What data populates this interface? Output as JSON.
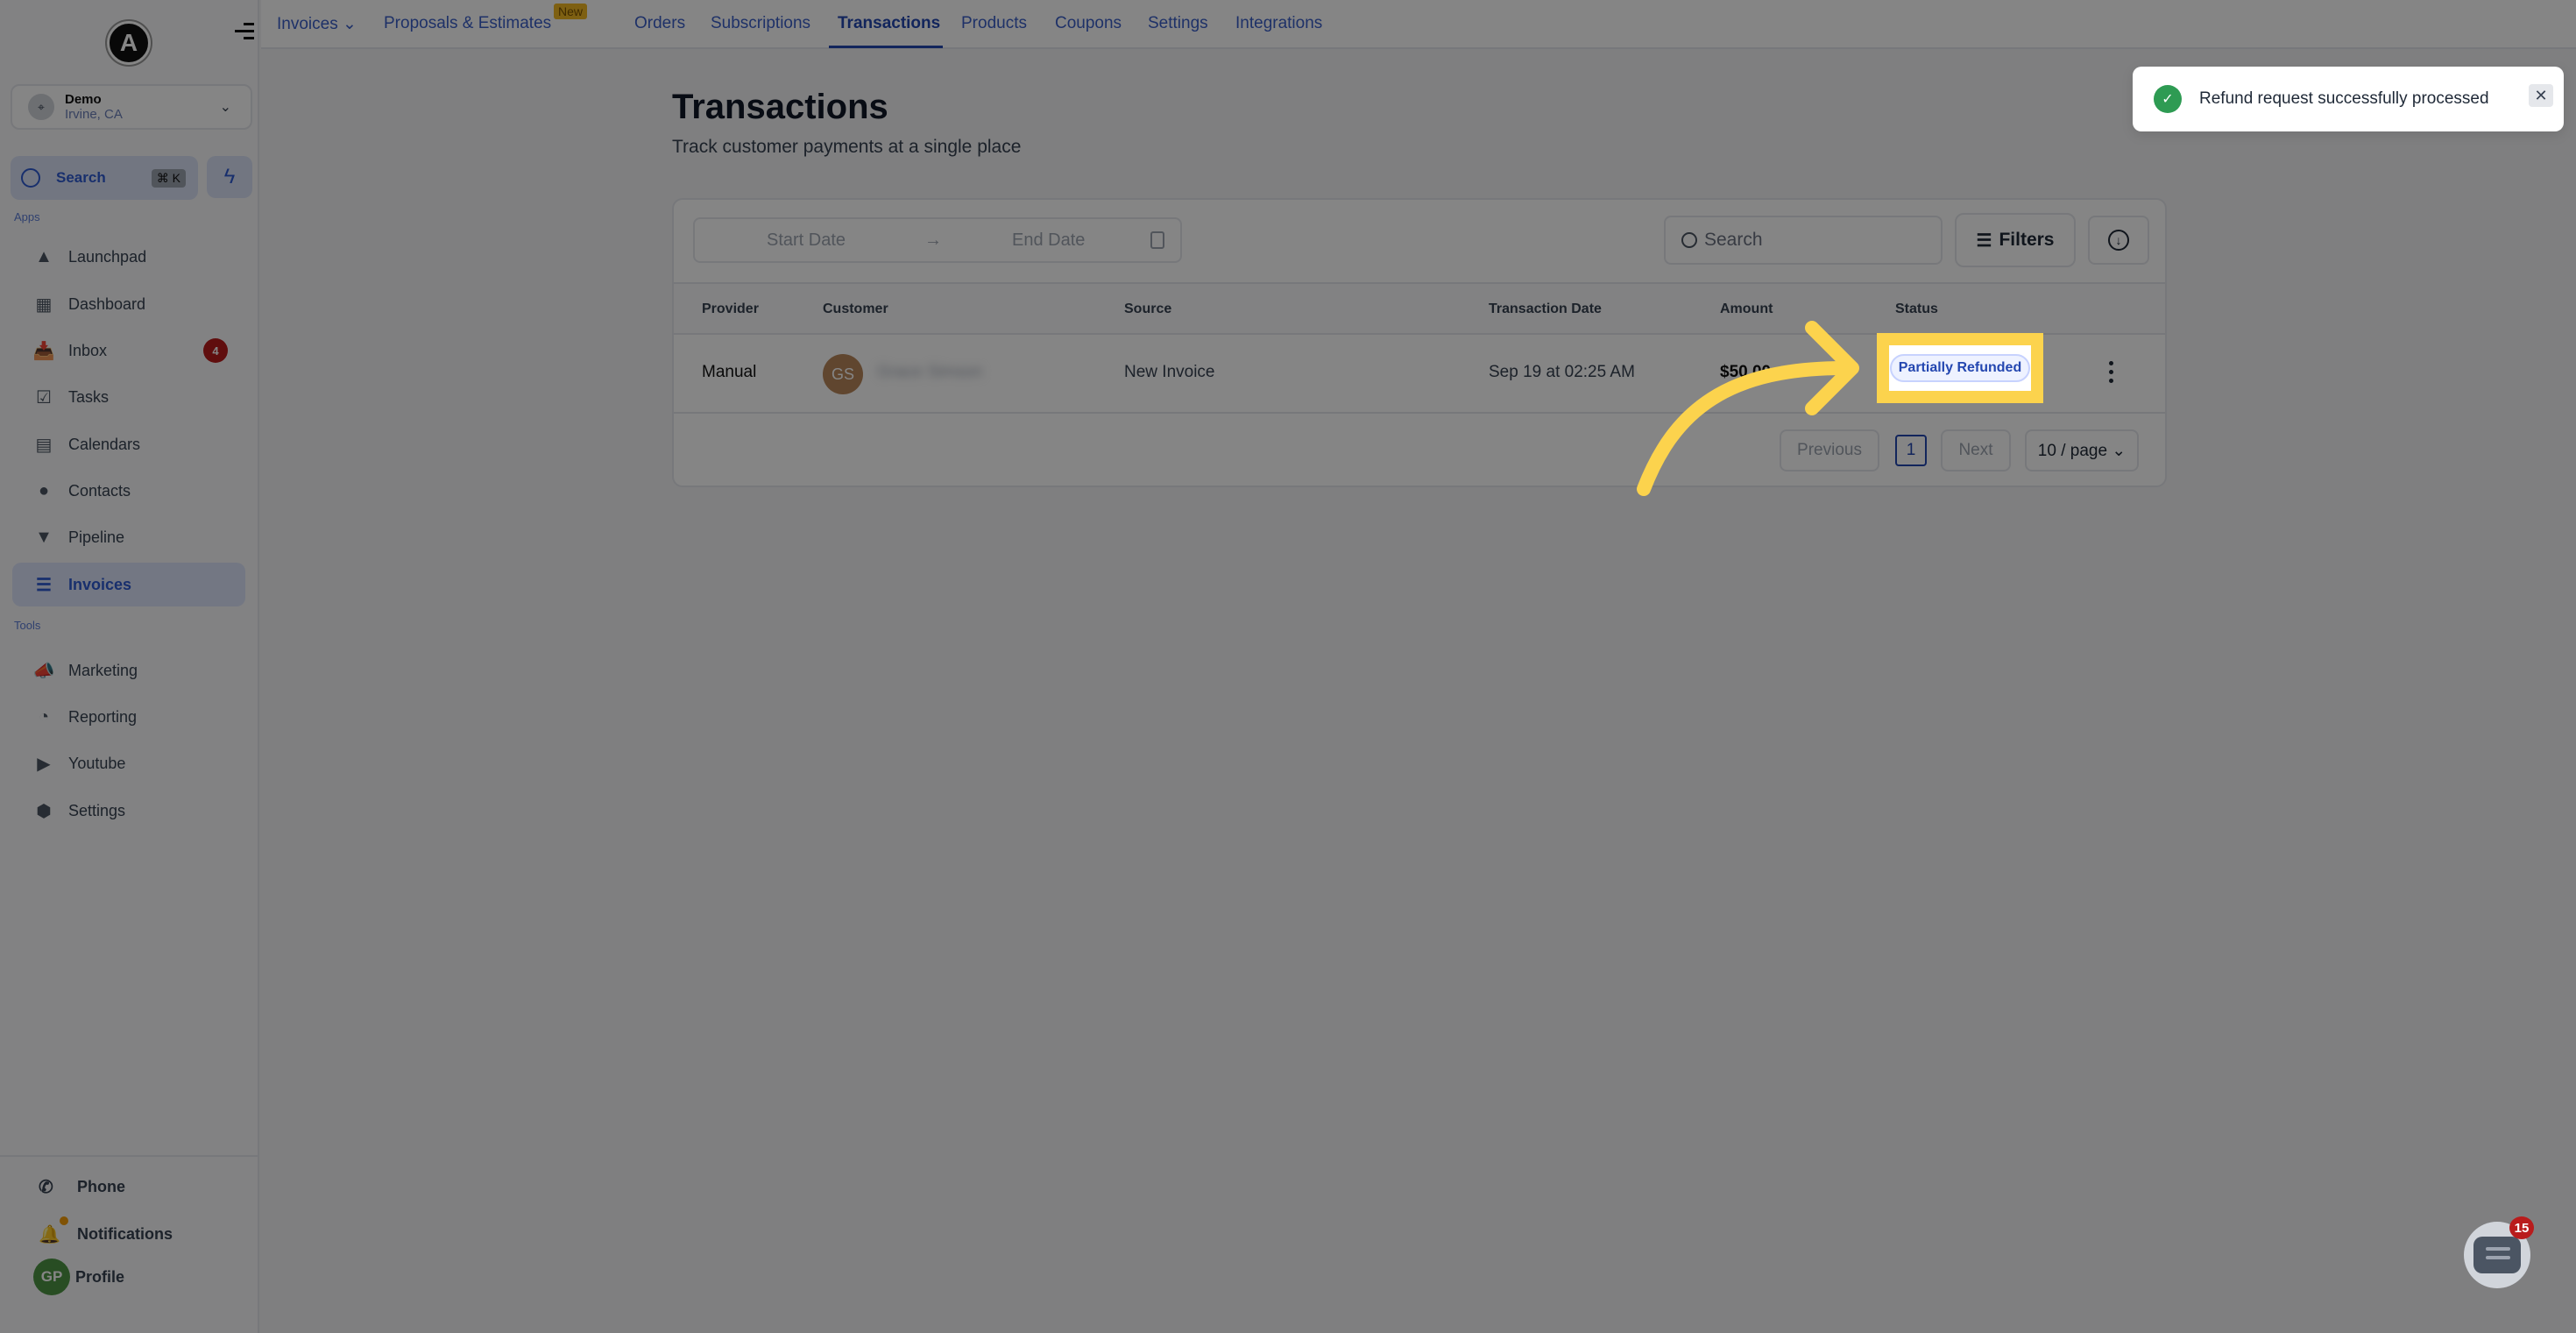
{
  "sidebar": {
    "logo_letter": "A",
    "location": {
      "name": "Demo",
      "sub": "Irvine, CA"
    },
    "search": {
      "label": "Search",
      "shortcut": "⌘ K"
    },
    "apps_label": "Apps",
    "tools_label": "Tools",
    "apps": [
      {
        "label": "Launchpad",
        "icon": "launchpad-icon"
      },
      {
        "label": "Dashboard",
        "icon": "dashboard-icon"
      },
      {
        "label": "Inbox",
        "icon": "inbox-icon",
        "badge": "4"
      },
      {
        "label": "Tasks",
        "icon": "tasks-icon"
      },
      {
        "label": "Calendars",
        "icon": "calendar-icon"
      },
      {
        "label": "Contacts",
        "icon": "contacts-icon"
      },
      {
        "label": "Pipeline",
        "icon": "pipeline-icon"
      },
      {
        "label": "Invoices",
        "icon": "invoices-icon",
        "active": true
      }
    ],
    "tools": [
      {
        "label": "Marketing",
        "icon": "megaphone-icon"
      },
      {
        "label": "Reporting",
        "icon": "pie-chart-icon"
      },
      {
        "label": "Youtube",
        "icon": "youtube-icon"
      },
      {
        "label": "Settings",
        "icon": "gear-icon"
      }
    ],
    "bottom": {
      "phone": "Phone",
      "notifications": "Notifications",
      "profile": "Profile",
      "profile_initials": "GP"
    }
  },
  "topnav": {
    "tabs": [
      {
        "label": "Invoices ⌄"
      },
      {
        "label": "Proposals & Estimates",
        "badge": "New"
      },
      {
        "label": "Orders"
      },
      {
        "label": "Subscriptions"
      },
      {
        "label": "Transactions",
        "active": true
      },
      {
        "label": "Products"
      },
      {
        "label": "Coupons"
      },
      {
        "label": "Settings"
      },
      {
        "label": "Integrations"
      }
    ]
  },
  "page": {
    "title": "Transactions",
    "subtitle": "Track customer payments at a single place"
  },
  "filters": {
    "start_date_placeholder": "Start Date",
    "arrow": "→",
    "end_date_placeholder": "End Date",
    "search_placeholder": "Search",
    "filters_label": "Filters"
  },
  "table": {
    "columns": [
      "Provider",
      "Customer",
      "Source",
      "Transaction Date",
      "Amount",
      "Status"
    ],
    "rows": [
      {
        "provider": "Manual",
        "customer_initials": "GS",
        "customer_name": "Grace Simson",
        "source": "New Invoice",
        "date": "Sep 19 at 02:25 AM",
        "amount": "$50.00",
        "status": "Partially Refunded"
      }
    ]
  },
  "pagination": {
    "previous": "Previous",
    "current": "1",
    "next": "Next",
    "page_size": "10 / page ⌄"
  },
  "toast": {
    "message": "Refund request successfully processed",
    "close": "✕"
  },
  "chat": {
    "badge": "15"
  },
  "colors": {
    "accent": "#2447b0",
    "highlight": "#fcd34d",
    "success": "#2e9b53",
    "danger": "#b91c1c"
  }
}
